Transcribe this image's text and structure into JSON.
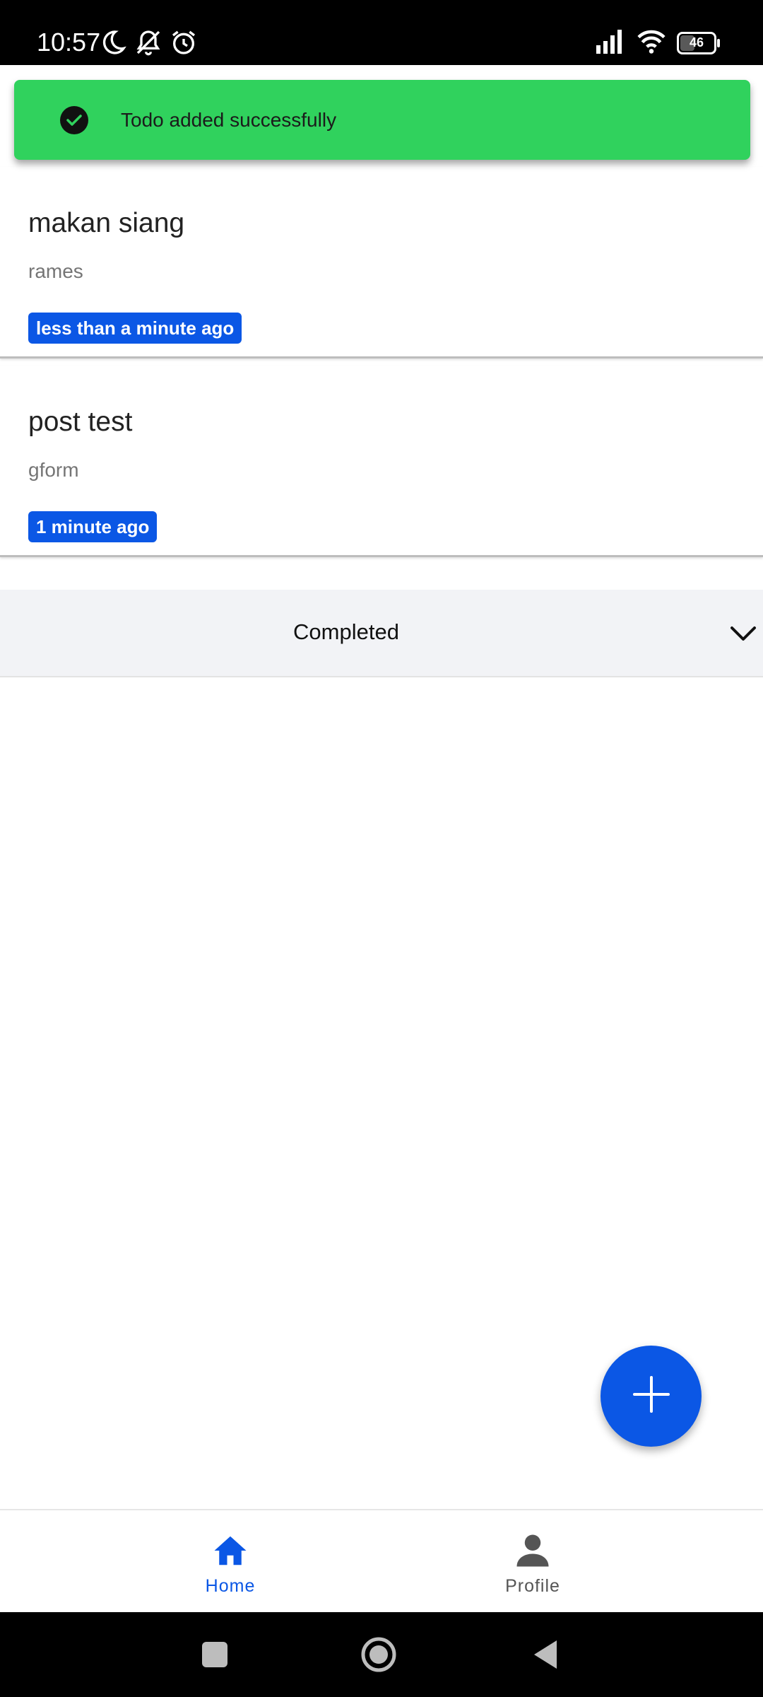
{
  "status_bar": {
    "time": "10:57",
    "battery": "46",
    "icons_left": [
      "moon-icon",
      "bell-off-icon",
      "alarm-icon"
    ],
    "icons_right": [
      "signal-icon",
      "wifi-icon",
      "battery-icon"
    ]
  },
  "toast": {
    "message": "Todo added successfully",
    "icon": "check-circle-icon",
    "color": "#30d25d"
  },
  "todos": [
    {
      "title": "makan siang",
      "description": "rames",
      "time": "less than a minute ago"
    },
    {
      "title": "post test",
      "description": "gform",
      "time": "1 minute ago"
    }
  ],
  "completed_section": {
    "label": "Completed",
    "icon": "chevron-down-icon"
  },
  "fab": {
    "icon": "plus-icon",
    "color": "#0b57e5"
  },
  "bottom_nav": {
    "items": [
      {
        "label": "Home",
        "icon": "home-icon",
        "active": true
      },
      {
        "label": "Profile",
        "icon": "person-icon",
        "active": false
      }
    ],
    "active_color": "#0b57e5"
  },
  "system_nav": {
    "buttons": [
      "recent-apps-icon",
      "home-circle-icon",
      "back-icon"
    ]
  }
}
